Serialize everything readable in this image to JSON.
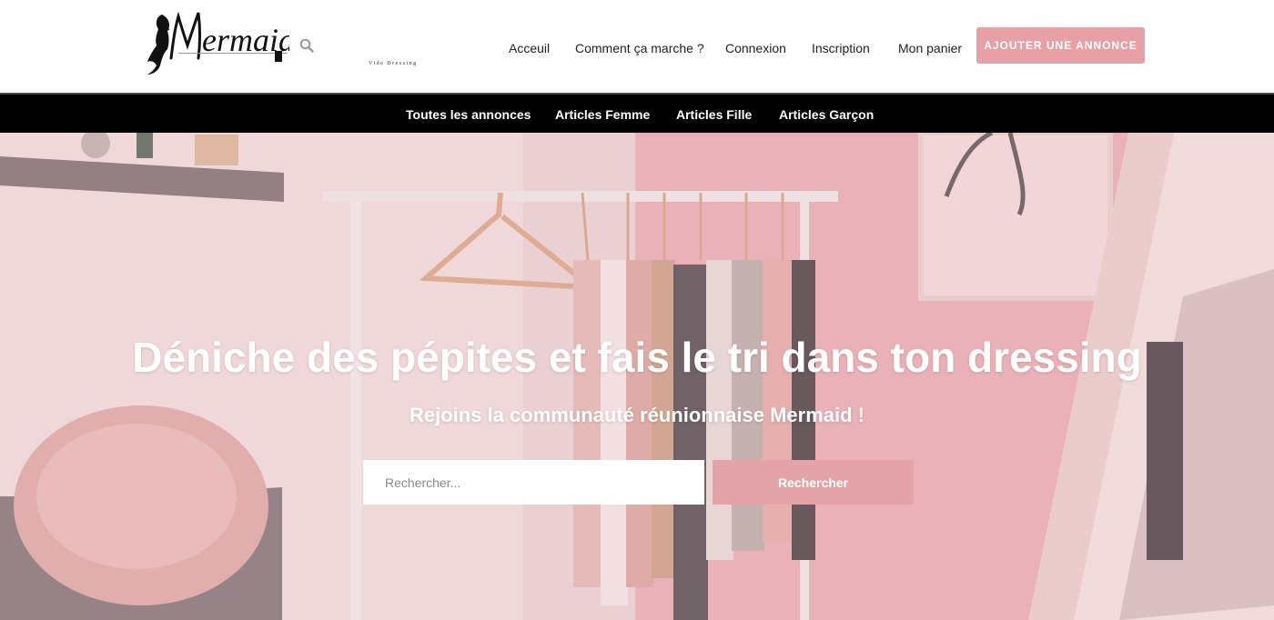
{
  "brand": {
    "logo_text": "Mermaid",
    "logo_subtitle": "Vide Dressing"
  },
  "header": {
    "nav": [
      "Acceuil",
      "Comment ça marche ?",
      "Connexion",
      "Inscription",
      "Mon panier"
    ],
    "cta_label": "AJOUTER UNE ANNONCE",
    "search_icon": "search-icon"
  },
  "categories": [
    "Toutes les annonces",
    "Articles Femme",
    "Articles Fille",
    "Articles Garçon"
  ],
  "hero": {
    "title": "Déniche des pépites et fais le tri dans ton dressing",
    "subtitle": "Rejoins la communauté réunionnaise Mermaid !",
    "search_placeholder": "Rechercher...",
    "search_button": "Rechercher"
  },
  "colors": {
    "accent": "#e7a0a6",
    "catbar": "#000000",
    "hero_tint": "#f0bec3"
  }
}
